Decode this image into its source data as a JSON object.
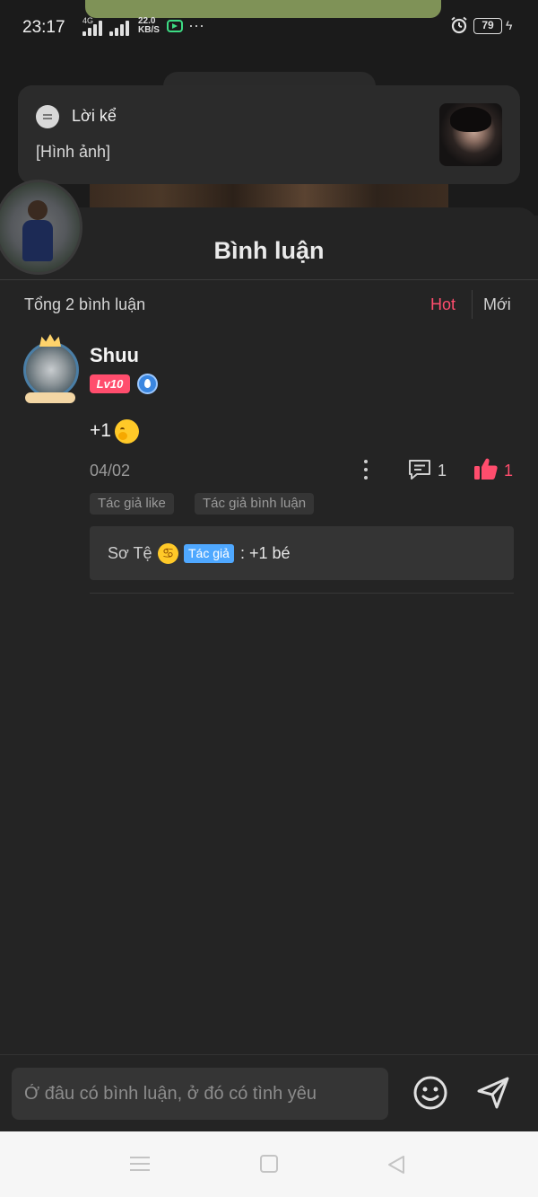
{
  "status_bar": {
    "time": "23:17",
    "signal_1_label": "4G",
    "speed_value": "22.0",
    "speed_unit": "KB/S",
    "more": "···",
    "battery": "79"
  },
  "notification": {
    "title": "Lời kể",
    "text": "[Hình ảnh]"
  },
  "sheet": {
    "title": "Bình luận",
    "total": "Tổng 2 bình luận",
    "sort_hot": "Hot",
    "sort_new": "Mới"
  },
  "comment": {
    "username": "Shuu",
    "level": "Lv10",
    "text": "+1",
    "date": "04/02",
    "reply_count": "1",
    "like_count": "1",
    "tags": [
      "Tác giả like",
      "Tác giả bình luận"
    ],
    "reply": {
      "user": "Sơ Tệ",
      "author_badge": "Tác giả",
      "text": ": +1 bé"
    }
  },
  "input": {
    "placeholder": "Ở đâu có bình luận, ở đó có tình yêu"
  },
  "colors": {
    "accent": "#ff4d6d",
    "author_badge": "#4fa8ff",
    "background": "#242424"
  },
  "icons": [
    "message-icon",
    "profile-avatar",
    "more-icon",
    "reply-icon",
    "like-icon",
    "smile-icon",
    "send-icon",
    "nav-menu-icon",
    "nav-home-icon",
    "nav-back-icon"
  ]
}
